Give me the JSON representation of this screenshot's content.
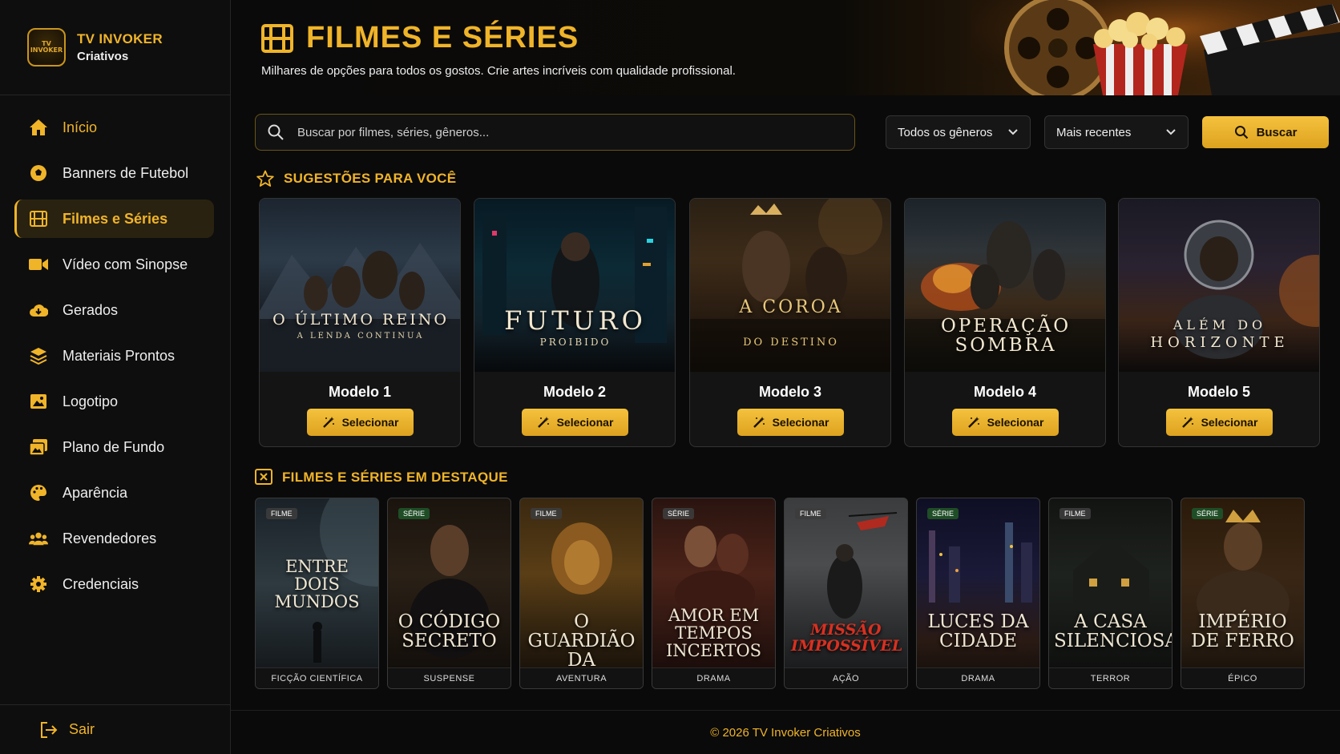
{
  "brand": {
    "name": "TV INVOKER",
    "subtitle": "Criativos",
    "logo_text": "TV INVOKER"
  },
  "sidebar": {
    "items": [
      {
        "label": "Início",
        "icon": "home-icon"
      },
      {
        "label": "Banners de Futebol",
        "icon": "soccer-ball-icon"
      },
      {
        "label": "Filmes e Séries",
        "icon": "film-icon"
      },
      {
        "label": "Vídeo com Sinopse",
        "icon": "video-camera-icon"
      },
      {
        "label": "Gerados",
        "icon": "cloud-download-icon"
      },
      {
        "label": "Materiais Prontos",
        "icon": "layers-icon"
      },
      {
        "label": "Logotipo",
        "icon": "image-icon"
      },
      {
        "label": "Plano de Fundo",
        "icon": "images-icon"
      },
      {
        "label": "Aparência",
        "icon": "palette-icon"
      },
      {
        "label": "Revendedores",
        "icon": "users-icon"
      },
      {
        "label": "Credenciais",
        "icon": "gear-icon"
      }
    ],
    "logout_label": "Sair"
  },
  "header": {
    "title": "FILMES E SÉRIES",
    "subtitle": "Milhares de opções para todos os gostos. Crie artes incríveis com qualidade profissional."
  },
  "search": {
    "placeholder": "Buscar por filmes, séries, gêneros...",
    "genre_selected": "Todos os gêneros",
    "order_selected": "Mais recentes",
    "button_label": "Buscar"
  },
  "suggestions": {
    "title": "SUGESTÕES PARA VOCÊ",
    "select_label": "Selecionar",
    "cards": [
      {
        "poster_title": "O ÚLTIMO REINO",
        "poster_subtitle": "A LENDA CONTINUA",
        "model": "Modelo 1"
      },
      {
        "poster_title": "FUTURO",
        "poster_subtitle": "PROIBIDO",
        "model": "Modelo 2"
      },
      {
        "poster_title": "A COROA",
        "poster_subtitle": "DO DESTINO",
        "model": "Modelo 3"
      },
      {
        "poster_title": "OPERAÇÃO",
        "poster_subtitle": "SOMBRA",
        "model": "Modelo 4"
      },
      {
        "poster_title": "ALÉM DO",
        "poster_subtitle": "HORIZONTE",
        "model": "Modelo 5"
      }
    ]
  },
  "featured": {
    "title": "FILMES E SÉRIES EM DESTAQUE",
    "items": [
      {
        "badge": "FILME",
        "title": "ENTRE DOIS MUNDOS",
        "genre": "FICÇÃO CIENTÍFICA"
      },
      {
        "badge": "SÉRIE",
        "title": "O CÓDIGO SECRETO",
        "genre": "SUSPENSE"
      },
      {
        "badge": "FILME",
        "title": "O GUARDIÃO DA FLORESTA",
        "genre": "AVENTURA"
      },
      {
        "badge": "SÉRIE",
        "title": "AMOR EM TEMPOS INCERTOS",
        "genre": "DRAMA"
      },
      {
        "badge": "FILME",
        "title": "MISSÃO IMPOSSÍVEL",
        "genre": "AÇÃO"
      },
      {
        "badge": "SÉRIE",
        "title": "LUCES DA CIDADE",
        "genre": "DRAMA"
      },
      {
        "badge": "FILME",
        "title": "A CASA SILENCIOSA",
        "genre": "TERROR"
      },
      {
        "badge": "SÉRIE",
        "title": "IMPÉRIO DE FERRO",
        "genre": "ÉPICO"
      }
    ]
  },
  "footer": {
    "text": "© 2026 TV Invoker Criativos"
  },
  "colors": {
    "accent": "#f0b429",
    "background": "#0b0b0b",
    "serie_badge": "#1f4d26"
  }
}
